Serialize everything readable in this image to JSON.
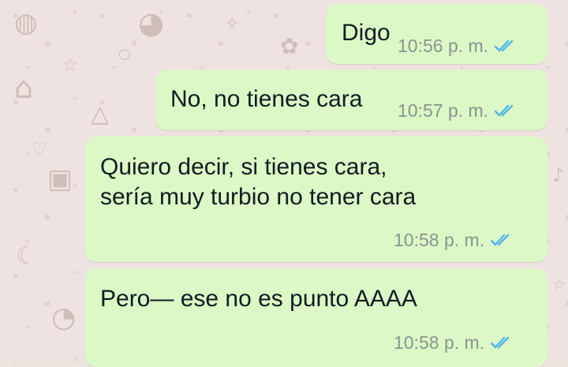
{
  "chat": {
    "messages": [
      {
        "text": "Digo",
        "time": "10:56 p. m.",
        "status_icon": "double-check-read-icon"
      },
      {
        "text": "No, no tienes cara",
        "time": "10:57 p. m.",
        "status_icon": "double-check-read-icon"
      },
      {
        "text": "Quiero decir, si tienes cara,\nsería muy turbio no tener cara",
        "time": "10:58 p. m.",
        "status_icon": "double-check-read-icon"
      },
      {
        "text": "Pero— ese no es punto AAAA",
        "time": "10:58 p. m.",
        "status_icon": "double-check-read-icon"
      }
    ]
  },
  "colors": {
    "outgoing_bubble": "#dcf8c6",
    "wallpaper": "#efe3e1",
    "read_ticks": "#4fb6ec",
    "timestamp": "#8a958e",
    "message_text": "#111b21"
  }
}
